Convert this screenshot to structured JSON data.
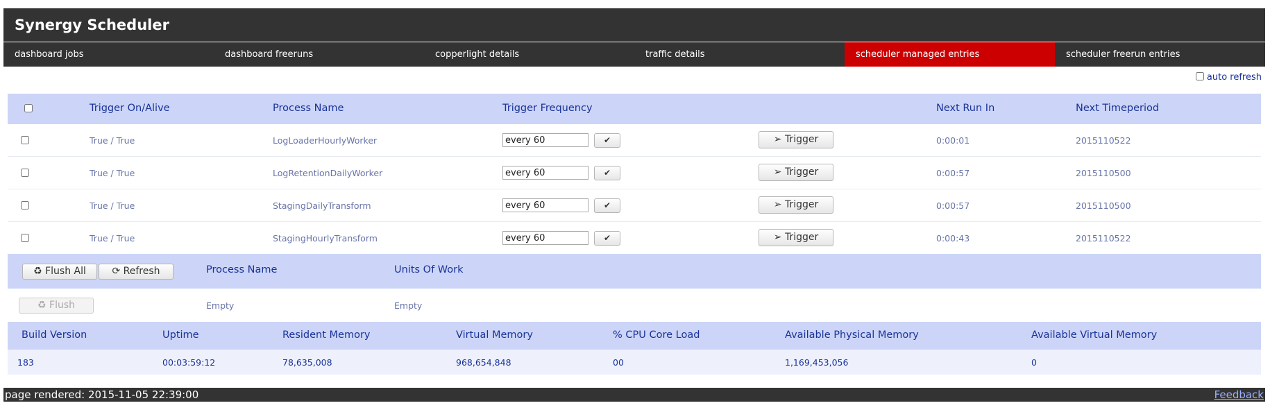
{
  "app": {
    "title": "Synergy Scheduler"
  },
  "nav": [
    {
      "label": "dashboard jobs"
    },
    {
      "label": "dashboard freeruns"
    },
    {
      "label": "copperlight details"
    },
    {
      "label": "traffic details"
    },
    {
      "label": "scheduler managed entries",
      "active": true
    },
    {
      "label": "scheduler freerun entries"
    }
  ],
  "auto_refresh": {
    "label": "auto refresh",
    "checked": false
  },
  "managed": {
    "headers": {
      "trigger_on_alive": "Trigger On/Alive",
      "process_name": "Process Name",
      "trigger_frequency": "Trigger Frequency",
      "next_run_in": "Next Run In",
      "next_timeperiod": "Next Timeperiod"
    },
    "trigger_button_label": "Trigger",
    "rows": [
      {
        "on_alive": "True / True",
        "process": "LogLoaderHourlyWorker",
        "frequency": "every 60",
        "next_run": "0:00:01",
        "timeperiod": "2015110522"
      },
      {
        "on_alive": "True / True",
        "process": "LogRetentionDailyWorker",
        "frequency": "every 60",
        "next_run": "0:00:57",
        "timeperiod": "2015110500"
      },
      {
        "on_alive": "True / True",
        "process": "StagingDailyTransform",
        "frequency": "every 60",
        "next_run": "0:00:57",
        "timeperiod": "2015110500"
      },
      {
        "on_alive": "True / True",
        "process": "StagingHourlyTransform",
        "frequency": "every 60",
        "next_run": "0:00:43",
        "timeperiod": "2015110522"
      }
    ]
  },
  "uow": {
    "flush_all_label": "Flush All",
    "refresh_label": "Refresh",
    "headers": {
      "process_name": "Process Name",
      "units_of_work": "Units Of Work"
    },
    "row": {
      "flush_label": "Flush",
      "process": "Empty",
      "units": "Empty"
    }
  },
  "stats": {
    "headers": {
      "build_version": "Build Version",
      "uptime": "Uptime",
      "resident_memory": "Resident Memory",
      "virtual_memory": "Virtual Memory",
      "cpu_load": "% CPU Core Load",
      "available_physical_memory": "Available Physical Memory",
      "available_virtual_memory": "Available Virtual Memory"
    },
    "values": {
      "build_version": "183",
      "uptime": "00:03:59:12",
      "resident_memory": "78,635,008",
      "virtual_memory": "968,654,848",
      "cpu_load": "00",
      "available_physical_memory": "1,169,453,056",
      "available_virtual_memory": "0"
    }
  },
  "footer": {
    "rendered": "page rendered: 2015-11-05 22:39:00",
    "feedback": "Feedback"
  },
  "colors": {
    "header_bg": "#333333",
    "active_tab": "#cc0000",
    "table_header_bg": "#ccd5f7",
    "header_text": "#1a3399"
  },
  "icons": {
    "check": "check-icon",
    "trigger": "paper-plane-icon",
    "flush": "recycle-icon",
    "refresh": "refresh-icon"
  }
}
